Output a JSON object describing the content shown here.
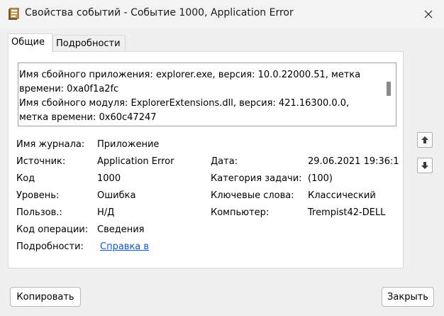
{
  "window": {
    "title": "Свойства событий - Событие 1000, Application Error"
  },
  "tabs": [
    {
      "label": "Общие",
      "active": true
    },
    {
      "label": "Подробности",
      "active": false
    }
  ],
  "description": {
    "lines": [
      "Имя сбойного приложения: explorer.exe, версия: 10.0.22000.51, метка",
      "времени: 0xa0f1a2fc",
      "Имя сбойного модуля: ExplorerExtensions.dll, версия: 421.16300.0.0,",
      "метка времени: 0x60c47247"
    ]
  },
  "fields": {
    "log_name_label": "Имя журнала:",
    "log_name_value": "Приложение",
    "source_label": "Источник:",
    "source_value": "Application Error",
    "date_label": "Дата:",
    "date_value": "29.06.2021 19:36:1",
    "code_label": "Код",
    "code_value": "1000",
    "task_category_label": "Категория задачи:",
    "task_category_value": "(100)",
    "level_label": "Уровень:",
    "level_value": "Ошибка",
    "keywords_label": "Ключевые слова:",
    "keywords_value": "Классический",
    "user_label": "Пользов.:",
    "user_value": "Н/Д",
    "computer_label": "Компьютер:",
    "computer_value": "Trempist42-DELL",
    "opcode_label": "Код операции:",
    "opcode_value": "Сведения",
    "more_info_label": "Подробности:",
    "more_info_link": "Справка в"
  },
  "buttons": {
    "copy": "Копировать",
    "close": "Закрыть"
  },
  "colors": {
    "link": "#0b57c9",
    "background": "#f0f0f0"
  }
}
